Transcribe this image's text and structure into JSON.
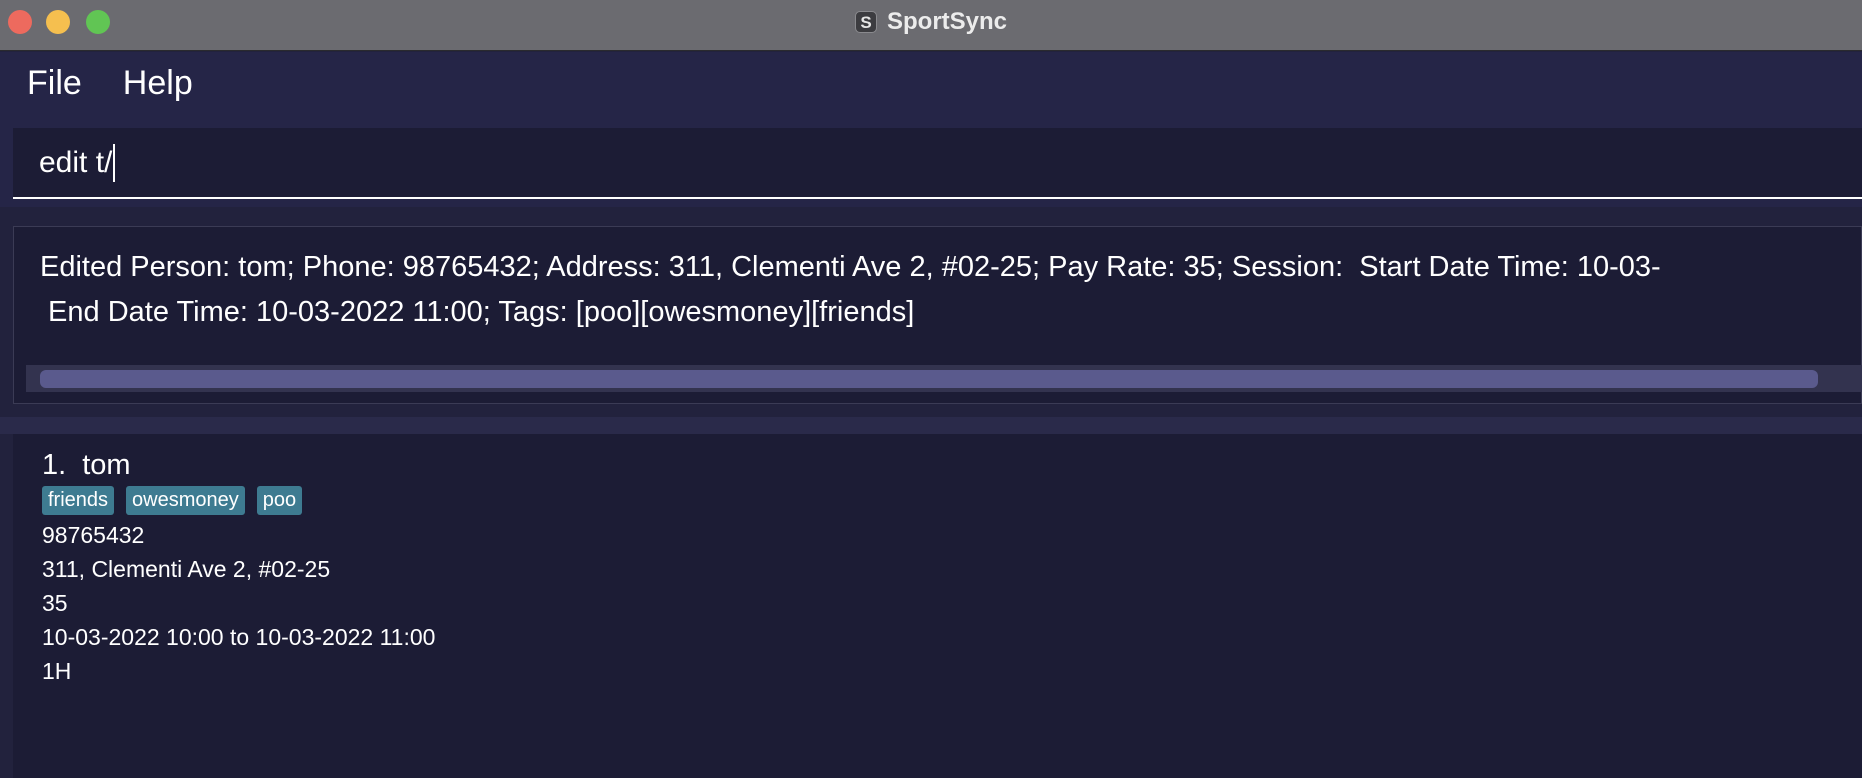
{
  "window": {
    "title": "SportSync",
    "app_icon_letter": "S"
  },
  "menu": {
    "file": "File",
    "help": "Help"
  },
  "command": {
    "value": "edit t/"
  },
  "result": {
    "line1": "Edited Person: tom; Phone: 98765432; Address: 311, Clementi Ave 2, #02-25; Pay Rate: 35; Session:  Start Date Time: 10-03-",
    "line2": " End Date Time: 10-03-2022 11:00; Tags: [poo][owesmoney][friends]"
  },
  "persons": [
    {
      "index": "1.",
      "name": "tom",
      "tags": [
        "friends",
        "owesmoney",
        "poo"
      ],
      "phone": "98765432",
      "address": "311, Clementi Ave 2, #02-25",
      "pay_rate": "35",
      "session": "10-03-2022 10:00 to 10-03-2022 11:00",
      "duration": "1H"
    }
  ],
  "colors": {
    "close": "#ed6a5e",
    "minimize": "#f5bf4f",
    "maximize": "#61c554",
    "tag_bg": "#3e7b91",
    "panel_bg": "#1c1c35"
  }
}
